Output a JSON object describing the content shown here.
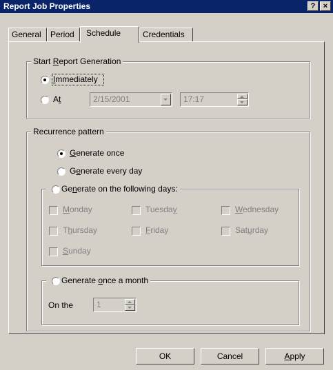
{
  "window": {
    "title": "Report Job Properties",
    "help_btn": "?",
    "close_btn": "×"
  },
  "tabs": [
    {
      "label": "General"
    },
    {
      "label": "Period"
    },
    {
      "label": "Schedule"
    },
    {
      "label": "Credentials"
    }
  ],
  "start": {
    "legend": "Start Report Generation",
    "immediately": "Immediately",
    "at": "At",
    "date": "2/15/2001",
    "time": "17:17"
  },
  "recurrence": {
    "legend": "Recurrence pattern",
    "once": "Generate once",
    "every_day": "Generate every day",
    "following_days": "Generate on the following days:",
    "days": [
      "Monday",
      "Tuesday",
      "Wednesday",
      "Thursday",
      "Friday",
      "Saturday",
      "Sunday"
    ],
    "once_month": "Generate once a month",
    "on_the": "On the",
    "day_value": "1"
  },
  "buttons": {
    "ok": "OK",
    "cancel": "Cancel",
    "apply": "Apply"
  }
}
